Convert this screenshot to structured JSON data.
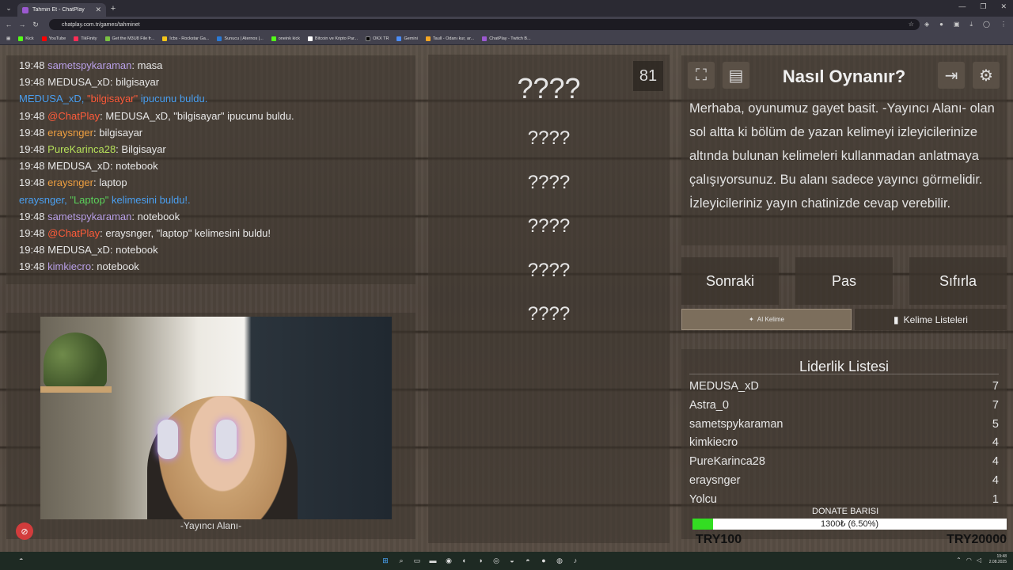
{
  "browser": {
    "tab_title": "Tahmin Et - ChatPlay",
    "url": "chatplay.com.tr/games/tahminet",
    "bookmarks": [
      "Kick",
      "YouTube",
      "TikFinity",
      "Get the M3U8 File fr...",
      "Icbs - Rockstar Ga...",
      "Sunucu | Aternos |...",
      "oneink kick",
      "Bitcoin ve Kripto Par...",
      "OKX TR",
      "Gemini",
      "Taull - Odanı kur, ar...",
      "ChatPlay - Twitch B..."
    ]
  },
  "chat": [
    {
      "time": "19:48",
      "user": "sametspykaraman",
      "color": "purple",
      "msg": ": masa"
    },
    {
      "time": "19:48",
      "user": "MEDUSA_xD",
      "color": "plain",
      "msg": ": bilgisayar"
    },
    {
      "system": true,
      "pre": "MEDUSA_xD, ",
      "hl": "\"bilgisayar\"",
      "post": " ipucunu buldu."
    },
    {
      "time": "19:48",
      "user": "@ChatPlay",
      "color": "red",
      "msg": ": MEDUSA_xD, \"bilgisayar\" ipucunu buldu."
    },
    {
      "time": "19:48",
      "user": "eraysnger",
      "color": "orange",
      "msg": ": bilgisayar"
    },
    {
      "time": "19:48",
      "user": "PureKarinca28",
      "color": "green",
      "msg": ": Bilgisayar"
    },
    {
      "time": "19:48",
      "user": "MEDUSA_xD",
      "color": "plain",
      "msg": ": notebook"
    },
    {
      "time": "19:48",
      "user": "eraysnger",
      "color": "orange",
      "msg": ": laptop"
    },
    {
      "system": true,
      "pre": "eraysnger, ",
      "hlg": "\"Laptop\"",
      "post": " kelimesini buldu!."
    },
    {
      "time": "19:48",
      "user": "sametspykaraman",
      "color": "purple",
      "msg": ": notebook"
    },
    {
      "time": "19:48",
      "user": "@ChatPlay",
      "color": "red",
      "msg": ": eraysnger, \"laptop\" kelimesini buldu!"
    },
    {
      "time": "19:48",
      "user": "MEDUSA_xD",
      "color": "plain",
      "msg": ": notebook"
    },
    {
      "time": "19:48",
      "user": "kimkiecro",
      "color": "purple",
      "msg": ": notebook"
    }
  ],
  "camera": {
    "label": "-Yayıncı Alanı-"
  },
  "words": {
    "counter": "81",
    "items": [
      "????",
      "????",
      "????",
      "????",
      "????",
      "????"
    ]
  },
  "info": {
    "title": "Nasıl Oynanır?",
    "text": "Merhaba, oyunumuz gayet basit. -Yayıncı Alanı- olan sol altta ki bölüm de yazan kelimeyi izleyicilerinize altında bulunan kelimeleri kullanmadan anlatmaya çalışıyorsunuz. Bu alanı sadece yayıncı görmelidir. İzleyicileriniz yayın chatinizde cevap verebilir."
  },
  "controls": {
    "next": "Sonraki",
    "pass": "Pas",
    "reset": "Sıfırla",
    "ai": "AI Kelime",
    "lists": "Kelime Listeleri"
  },
  "leaderboard": {
    "title": "Liderlik Listesi",
    "rows": [
      {
        "name": "MEDUSA_xD",
        "score": "7"
      },
      {
        "name": "Astra_0",
        "score": "7"
      },
      {
        "name": "sametspykaraman",
        "score": "5"
      },
      {
        "name": "kimkiecro",
        "score": "4"
      },
      {
        "name": "PureKarinca28",
        "score": "4"
      },
      {
        "name": "eraysnger",
        "score": "4"
      },
      {
        "name": "Yolcu",
        "score": "1"
      }
    ]
  },
  "donate": {
    "title": "DONATE BARISI",
    "text": "1300₺ (6.50%)",
    "progress": 0.065,
    "min": "TRY100",
    "max": "TRY20000"
  },
  "taskbar": {
    "date": "2.08.2025",
    "time": "19:48"
  }
}
